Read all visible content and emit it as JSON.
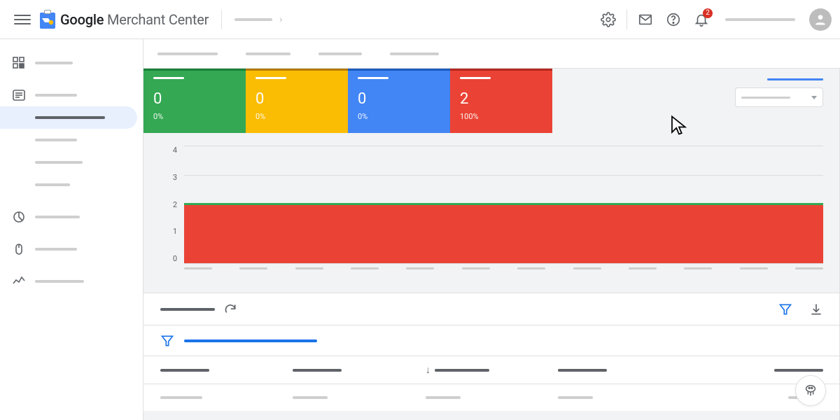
{
  "header": {
    "brand_google": "Google",
    "brand_mc": " Merchant Center",
    "notification_count": "2"
  },
  "status_cards": [
    {
      "color": "green",
      "value": "0",
      "pct": "0%"
    },
    {
      "color": "yellow",
      "value": "0",
      "pct": "0%"
    },
    {
      "color": "blue",
      "value": "0",
      "pct": "0%"
    },
    {
      "color": "red",
      "value": "2",
      "pct": "100%"
    }
  ],
  "chart_data": {
    "type": "area",
    "ylim": [
      0,
      4
    ],
    "yticks": [
      "4",
      "3",
      "2",
      "1",
      "0"
    ],
    "x_count": 12,
    "series": [
      {
        "name": "red-area",
        "value": 2,
        "fill": "#ea4335"
      },
      {
        "name": "green-line",
        "value": 2,
        "stroke": "#34a853"
      }
    ]
  },
  "table": {
    "column_count": 5,
    "sort_col_index": 2,
    "rows": 1
  }
}
